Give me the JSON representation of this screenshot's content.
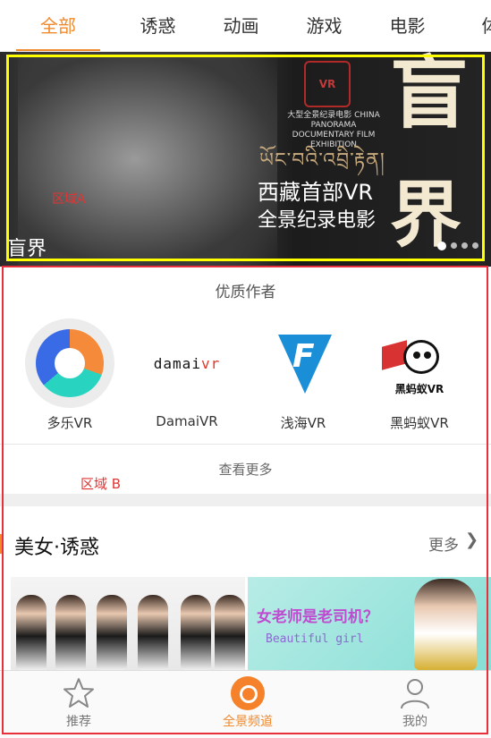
{
  "tabs": [
    {
      "label": "全部",
      "active": true
    },
    {
      "label": "诱惑",
      "active": false
    },
    {
      "label": "动画",
      "active": false
    },
    {
      "label": "游戏",
      "active": false
    },
    {
      "label": "电影",
      "active": false
    },
    {
      "label": "体",
      "active": false
    }
  ],
  "banner": {
    "seal_text": "VR",
    "small_caption": "大型全景纪录电影 CHINA PANORAMA DOCUMENTARY FILM EXHIBITION",
    "tibetan_text": "ཡོང་བའི་འབྲི་རྟེན།",
    "line1": "西藏首部VR",
    "line2": "全景纪录电影",
    "big_char1": "盲",
    "big_char2": "界",
    "caption": "盲界",
    "area_label": "区域A",
    "slide_index": 1,
    "slide_count": 4
  },
  "authors": {
    "title": "优质作者",
    "items": [
      {
        "name": "多乐VR",
        "logo": "duole-logo"
      },
      {
        "name": "DamaiVR",
        "logo": "damai-logo",
        "logo_text_a": "damai",
        "logo_text_b": "vr"
      },
      {
        "name": "浅海VR",
        "logo": "qianhai-logo",
        "logo_letter": "F"
      },
      {
        "name": "黑蚂蚁VR",
        "logo": "heimayi-logo",
        "logo_text": "黑蚂蚁VR"
      }
    ],
    "see_more": "查看更多",
    "area_label": "区域 B"
  },
  "beauty": {
    "title": "美女·诱惑",
    "more": "更多",
    "thumb2_title": "女老师是老司机？",
    "thumb2_sub": "Beautiful girl"
  },
  "bottom_nav": [
    {
      "label": "推荐",
      "icon": "star-icon",
      "active": false
    },
    {
      "label": "全景频道",
      "icon": "panorama-icon",
      "active": true
    },
    {
      "label": "我的",
      "icon": "person-icon",
      "active": false
    }
  ],
  "colors": {
    "accent": "#f08a2d",
    "annotation_red": "#e8303a",
    "annotation_yellow": "#ffff00"
  }
}
